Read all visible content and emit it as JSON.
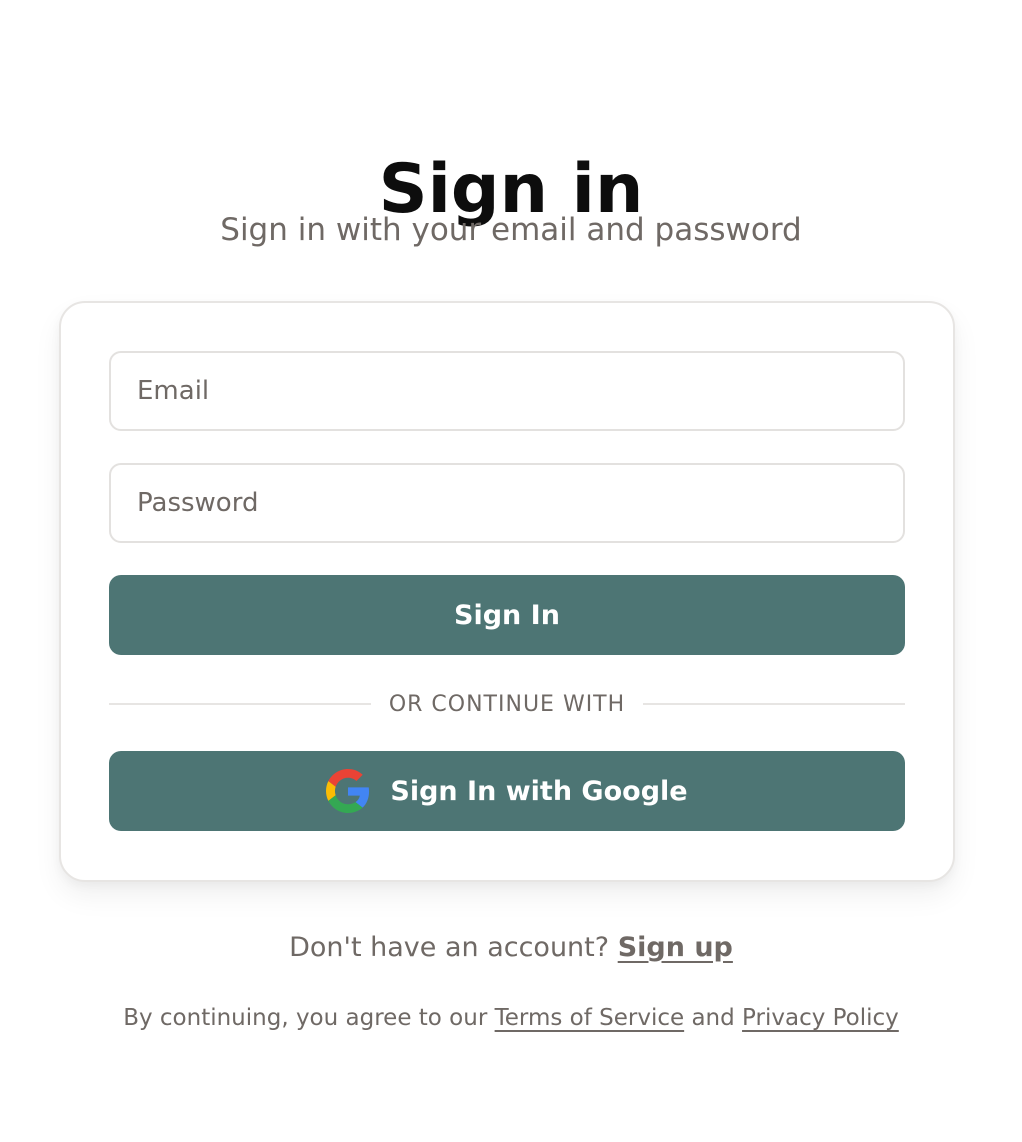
{
  "header": {
    "title": "Sign in",
    "subtitle": "Sign in with your email and password"
  },
  "form": {
    "email": {
      "placeholder": "Email",
      "value": ""
    },
    "password": {
      "placeholder": "Password",
      "value": ""
    },
    "submit_label": "Sign In",
    "divider_label": "OR CONTINUE WITH",
    "google_label": "Sign In with Google",
    "google_icon": "google-g-icon"
  },
  "footer": {
    "signup_prompt": "Don't have an account?",
    "signup_link": "Sign up",
    "legal_prefix": "By continuing, you agree to our",
    "terms_link": "Terms of Service",
    "legal_and": "and",
    "privacy_link": "Privacy Policy"
  },
  "colors": {
    "button_bg": "#4d7574",
    "muted_text": "#6f6965",
    "border": "#e3e1df"
  }
}
